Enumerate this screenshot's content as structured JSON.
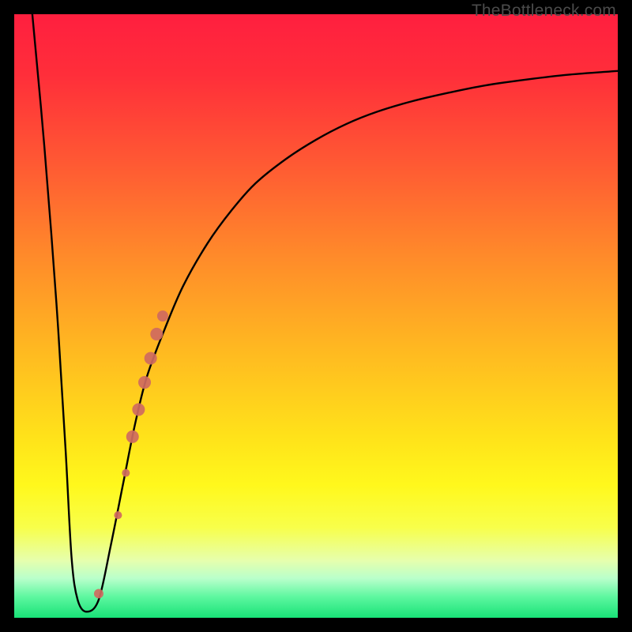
{
  "watermark": "TheBottleneck.com",
  "colors": {
    "frame": "#000000",
    "curve": "#000000",
    "marker_fill": "#cf6a5f",
    "marker_stroke": "#cf6a5f"
  },
  "gradient_stops": [
    {
      "offset": 0.0,
      "color": "#ff1f3f"
    },
    {
      "offset": 0.1,
      "color": "#ff2e3a"
    },
    {
      "offset": 0.25,
      "color": "#ff5a33"
    },
    {
      "offset": 0.4,
      "color": "#ff8a2a"
    },
    {
      "offset": 0.55,
      "color": "#ffb721"
    },
    {
      "offset": 0.7,
      "color": "#ffe21a"
    },
    {
      "offset": 0.78,
      "color": "#fff81c"
    },
    {
      "offset": 0.85,
      "color": "#f8ff4a"
    },
    {
      "offset": 0.905,
      "color": "#e6ffad"
    },
    {
      "offset": 0.935,
      "color": "#b9ffcb"
    },
    {
      "offset": 0.965,
      "color": "#5ef7a0"
    },
    {
      "offset": 1.0,
      "color": "#18e277"
    }
  ],
  "chart_data": {
    "type": "line",
    "title": "",
    "xlabel": "",
    "ylabel": "",
    "xlim": [
      0,
      100
    ],
    "ylim": [
      0,
      100
    ],
    "series": [
      {
        "name": "bottleneck-curve",
        "x": [
          3,
          5,
          7,
          8.5,
          9.5,
          10.5,
          12,
          14,
          16,
          18,
          20,
          22,
          25,
          28,
          32,
          36,
          40,
          45,
          50,
          55,
          60,
          66,
          72,
          78,
          85,
          92,
          100
        ],
        "y": [
          100,
          78,
          52,
          28,
          10,
          3,
          1,
          3,
          12,
          22,
          32,
          40,
          48,
          55,
          62,
          67.5,
          72,
          76,
          79.2,
          81.8,
          83.8,
          85.6,
          87,
          88.2,
          89.2,
          90,
          90.6
        ]
      }
    ],
    "markers": [
      {
        "x": 14.0,
        "y": 4.0,
        "r": 6
      },
      {
        "x": 17.2,
        "y": 17.0,
        "r": 5
      },
      {
        "x": 18.5,
        "y": 24.0,
        "r": 5
      },
      {
        "x": 19.6,
        "y": 30.0,
        "r": 8
      },
      {
        "x": 20.6,
        "y": 34.5,
        "r": 8
      },
      {
        "x": 21.6,
        "y": 39.0,
        "r": 8
      },
      {
        "x": 22.6,
        "y": 43.0,
        "r": 8
      },
      {
        "x": 23.6,
        "y": 47.0,
        "r": 8
      },
      {
        "x": 24.6,
        "y": 50.0,
        "r": 7
      }
    ]
  }
}
